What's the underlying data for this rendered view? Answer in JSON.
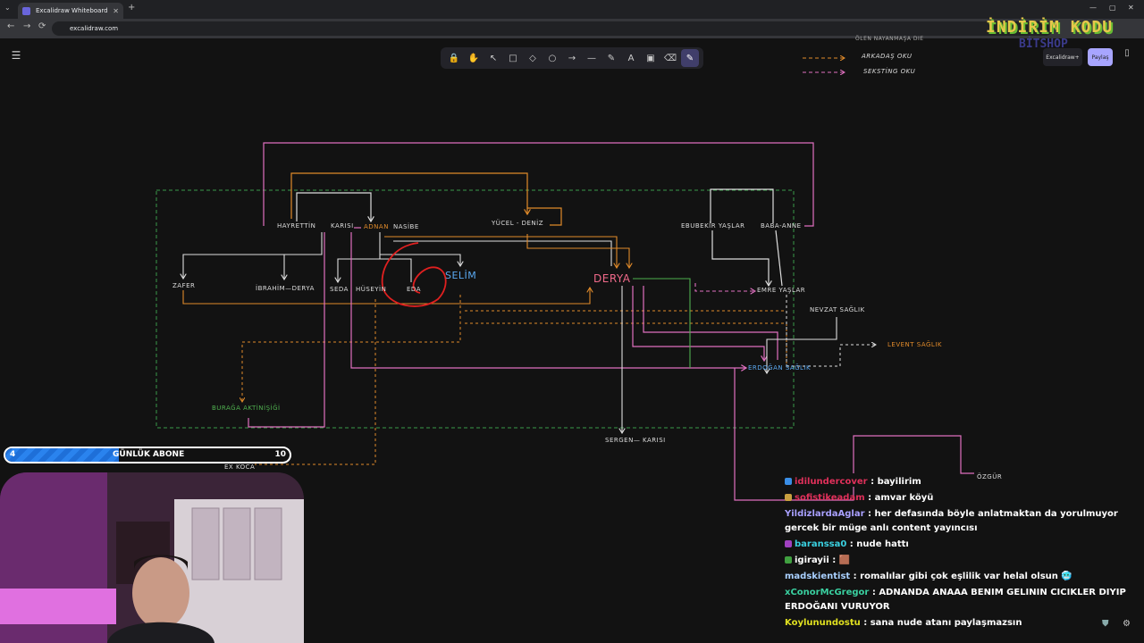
{
  "browser": {
    "tab_title": "Excalidraw Whiteboard",
    "url": "excalidraw.com",
    "new_tab": "+",
    "back": "←",
    "forward": "→",
    "reload": "⟳"
  },
  "toolbar": {
    "tools": [
      "lock-icon",
      "hand-icon",
      "select-icon",
      "rectangle-icon",
      "diamond-icon",
      "ellipse-icon",
      "arrow-icon",
      "line-icon",
      "draw-icon",
      "text-icon",
      "image-icon",
      "eraser-icon",
      "laser-icon"
    ],
    "glyphs": [
      "🔒",
      "✋",
      "↖",
      "□",
      "◇",
      "○",
      "→",
      "—",
      "✎",
      "A",
      "▣",
      "⌫",
      "✎"
    ]
  },
  "header": {
    "excalidraw_plus": "Excalidraw+",
    "share": "Paylaş"
  },
  "legend": {
    "top_partial": "ÖLEN NAYANMAŞA DIE",
    "friend_arrow": "ARKADAŞ OKU",
    "sexting_arrow": "SEKSTİNG OKU"
  },
  "overlay": {
    "logo": "İNDİRİM KODU",
    "sub": "BİTSHOP"
  },
  "diagram": {
    "names": [
      {
        "id": "hayrettin",
        "text": "HAYRETTİN",
        "color": "#dddddd"
      },
      {
        "id": "karisi1",
        "text": "KARISI",
        "color": "#dddddd"
      },
      {
        "id": "adnan",
        "text": "ADNAN",
        "color": "#e08a2a"
      },
      {
        "id": "nasibe",
        "text": "NASİBE",
        "color": "#dddddd"
      },
      {
        "id": "yucel",
        "text": "YÜCEL  -  DENİZ",
        "color": "#dddddd"
      },
      {
        "id": "ebubekir",
        "text": "EBUBEKİR YAŞLAR",
        "color": "#dddddd"
      },
      {
        "id": "baba",
        "text": "BABA-ANNE",
        "color": "#dddddd"
      },
      {
        "id": "zafer",
        "text": "ZAFER",
        "color": "#dddddd"
      },
      {
        "id": "ibrahim",
        "text": "İBRAHİM—DERYA",
        "color": "#dddddd"
      },
      {
        "id": "seda",
        "text": "SEDA",
        "color": "#dddddd"
      },
      {
        "id": "huseyin",
        "text": "HÜSEYİN",
        "color": "#dddddd"
      },
      {
        "id": "eda",
        "text": "EDA",
        "color": "#dddddd"
      },
      {
        "id": "selim",
        "text": "SELİM",
        "color": "#5aa8f0"
      },
      {
        "id": "derya",
        "text": "DERYA",
        "color": "#f06a8a"
      },
      {
        "id": "emre",
        "text": "EMRE YAŞLAR",
        "color": "#dddddd"
      },
      {
        "id": "nevzat",
        "text": "NEVZAT SAĞLIK",
        "color": "#dddddd"
      },
      {
        "id": "levent",
        "text": "LEVENT SAĞLIK",
        "color": "#e08a2a"
      },
      {
        "id": "erdogan",
        "text": "ERDOĞAN SAĞLIK",
        "color": "#5aa8f0"
      },
      {
        "id": "burak",
        "text": "BURAĞA AKTİNİŞİĞİ",
        "color": "#4fb04f"
      },
      {
        "id": "sergen",
        "text": "SERGEN— KARISI",
        "color": "#dddddd"
      },
      {
        "id": "exkoca",
        "text": "EX KOCA",
        "color": "#dddddd"
      },
      {
        "id": "ozgur",
        "text": "ÖZGÜR",
        "color": "#dddddd"
      }
    ]
  },
  "subgoal": {
    "current": "4",
    "label": "GÜNLÜK ABONE",
    "target": "10",
    "progress": 0.4
  },
  "chat": [
    {
      "user": "idilundercover",
      "color": "#e0305a",
      "text": "bayilirim",
      "badge": "#3a8ee6"
    },
    {
      "user": "sofistikeadam",
      "color": "#e0305a",
      "text": "amvar köyü",
      "badge": "#c9a040"
    },
    {
      "user": "YildizlardaAglar",
      "color": "#a9a0ff",
      "text": "her defasında böyle anlatmaktan da yorulmuyor gercek bir müge anlı content yayıncısı",
      "badge": ""
    },
    {
      "user": "baranssa0",
      "color": "#3ad0e0",
      "text": "nude hattı",
      "badge": "#a040c0"
    },
    {
      "user": "igirayii",
      "color": "#ffffff",
      "text": "🟫",
      "badge": "#40a040"
    },
    {
      "user": "madskientist",
      "color": "#a9d0ff",
      "text": "romalılar gibi çok eşlilik var helal olsun 🥶",
      "badge": ""
    },
    {
      "user": "xConorMcGregor",
      "color": "#3ad0a0",
      "text": "ADNANDA ANAAA BENIM GELININ CICIKLER DIYIP ERDOĞANI VURUYOR",
      "badge": ""
    },
    {
      "user": "Koylunundostu",
      "color": "#e0e020",
      "text": "sana nude atanı paylaşmazsın",
      "badge": ""
    }
  ]
}
